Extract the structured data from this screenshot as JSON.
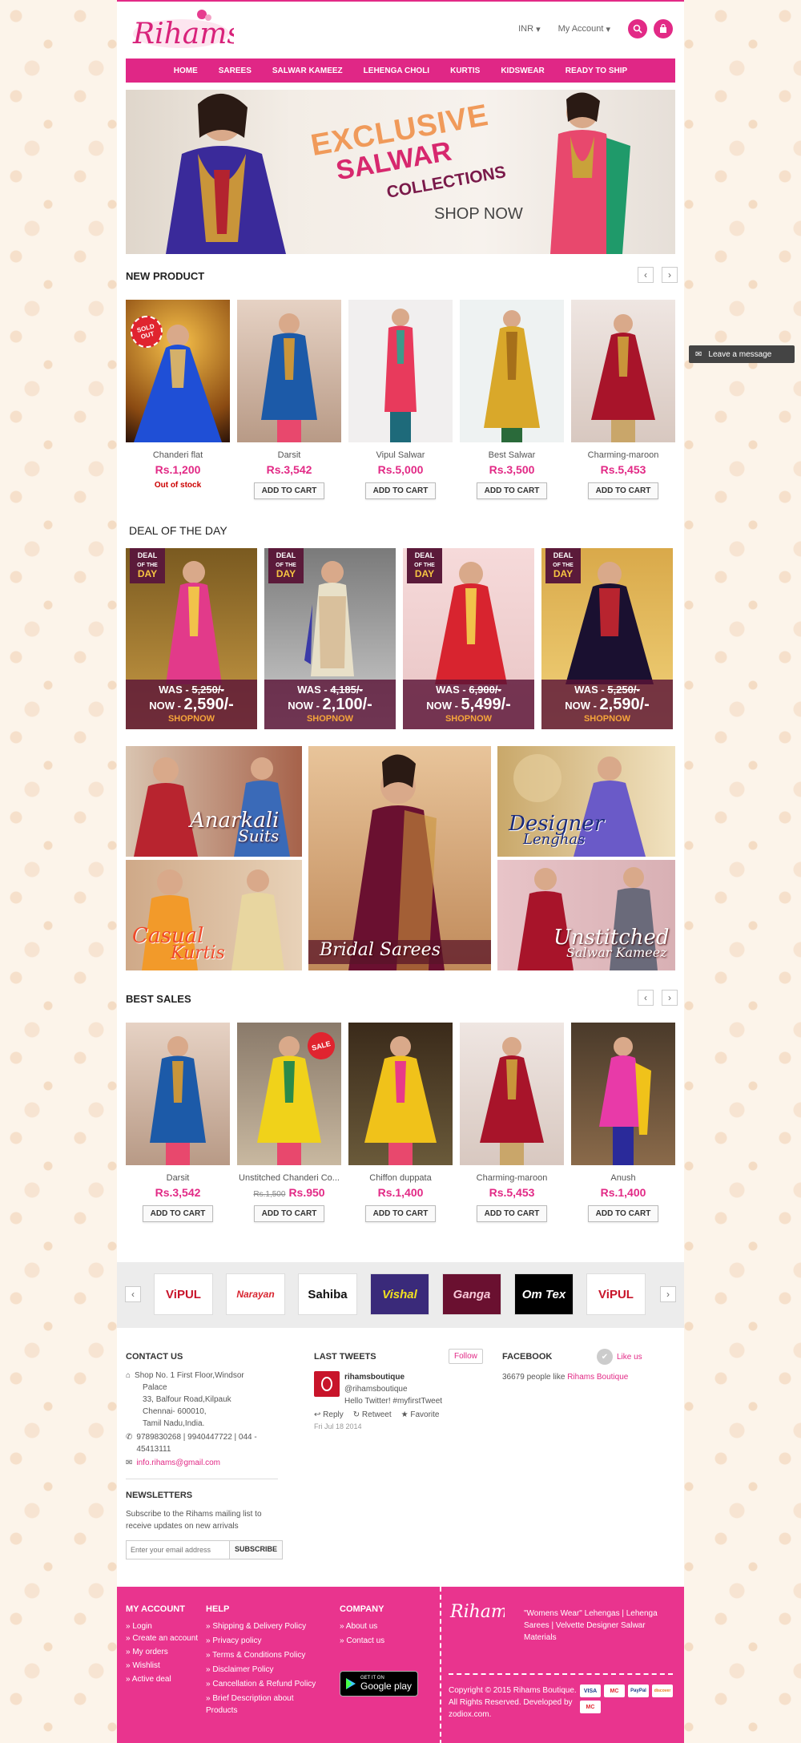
{
  "header": {
    "logo_text": "Rihams",
    "currency": "INR",
    "account": "My Account"
  },
  "nav": [
    "HOME",
    "SAREES",
    "SALWAR KAMEEZ",
    "LEHENGA CHOLI",
    "KURTIS",
    "KIDSWEAR",
    "READY TO SHIP"
  ],
  "banner": {
    "line1": "EXCLUSIVE",
    "line2": "SALWAR",
    "line3": "COLLECTIONS",
    "cta": "SHOP NOW"
  },
  "new_product": {
    "title": "NEW PRODUCT",
    "items": [
      {
        "name": "Chanderi flat",
        "price": "Rs.1,200",
        "status": "Out of stock",
        "badge": "SOLD OUT"
      },
      {
        "name": "Darsit",
        "price": "Rs.3,542",
        "cta": "ADD TO CART"
      },
      {
        "name": "Vipul Salwar",
        "price": "Rs.5,000",
        "cta": "ADD TO CART"
      },
      {
        "name": "Best Salwar",
        "price": "Rs.3,500",
        "cta": "ADD TO CART"
      },
      {
        "name": "Charming-maroon",
        "price": "Rs.5,453",
        "cta": "ADD TO CART"
      }
    ]
  },
  "deal": {
    "title": "DEAL OF THE DAY",
    "badge_top": "DEAL",
    "badge_mid": "OF THE",
    "badge_bottom": "DAY",
    "was_label": "WAS -",
    "now_label": "NOW -",
    "shop": "SHOPNOW",
    "items": [
      {
        "was": "5,250/-",
        "now": "2,590/-"
      },
      {
        "was": "4,185/-",
        "now": "2,100/-"
      },
      {
        "was": "6,900/-",
        "now": "5,499/-"
      },
      {
        "was": "5,250/-",
        "now": "2,590/-"
      }
    ]
  },
  "categories": [
    {
      "line1": "Anarkali",
      "line2": "Suits"
    },
    {
      "line1": "Casual",
      "line2": "Kurtis"
    },
    {
      "line1": "Bridal Sarees",
      "line2": ""
    },
    {
      "line1": "Designer",
      "line2": "Lenghas"
    },
    {
      "line1": "Unstitched",
      "line2": "Salwar Kameez"
    }
  ],
  "best_sales": {
    "title": "BEST SALES",
    "items": [
      {
        "name": "Darsit",
        "price": "Rs.3,542",
        "cta": "ADD TO CART"
      },
      {
        "name": "Unstitched Chanderi Co...",
        "old": "Rs.1,500",
        "price": "Rs.950",
        "cta": "ADD TO CART",
        "badge": "SALE"
      },
      {
        "name": "Chiffon duppata",
        "price": "Rs.1,400",
        "cta": "ADD TO CART"
      },
      {
        "name": "Charming-maroon",
        "price": "Rs.5,453",
        "cta": "ADD TO CART"
      },
      {
        "name": "Anush",
        "price": "Rs.1,400",
        "cta": "ADD TO CART"
      }
    ]
  },
  "brands": [
    "ViPUL",
    "Narayan",
    "Sahiba",
    "Vishal",
    "Ganga",
    "Om Tex",
    "ViPUL"
  ],
  "contact": {
    "title": "CONTACT US",
    "address": [
      "Shop No. 1 First Floor,Windsor",
      "Palace",
      "33, Balfour Road,Kilpauk",
      "Chennai- 600010,",
      "Tamil Nadu,India."
    ],
    "phone": "9789830268 | 9940447722 | 044 - 45413111",
    "email": "info.rihams@gmail.com"
  },
  "tweets": {
    "title": "LAST TWEETS",
    "follow": "Follow",
    "user": "rihamsboutique",
    "handle": "@rihamsboutique",
    "text": "Hello Twitter! #myfirstTweet",
    "reply": "Reply",
    "retweet": "Retweet",
    "favorite": "Favorite",
    "date": "Fri Jul 18 2014"
  },
  "facebook": {
    "title": "FACEBOOK",
    "like": "Like us",
    "people": "36679 people like",
    "page": "Rihams Boutique"
  },
  "newsletter": {
    "title": "NEWSLETTERS",
    "desc": "Subscribe to the Rihams mailing list to receive updates on new arrivals",
    "placeholder": "Enter your email address",
    "button": "SUBSCRIBE"
  },
  "footer": {
    "account_title": "MY ACCOUNT",
    "account": [
      "Login",
      "Create an account",
      "My orders",
      "Wishlist",
      "Active deal"
    ],
    "help_title": "HELP",
    "help": [
      "Shipping & Delivery Policy",
      "Privacy policy",
      "Terms & Conditions Policy",
      "Disclaimer Policy",
      "Cancellation & Refund Policy",
      "Brief Description about Products"
    ],
    "company_title": "COMPANY",
    "company": [
      "About us",
      "Contact us"
    ],
    "play_small": "GET IT ON",
    "play_big": "Google play",
    "tagline": "\"Womens Wear\" Lehengas | Lehenga Sarees | Velvette Designer Salwar Materials",
    "copyright": "Copyright © 2015 Rihams Boutique. All Rights Reserved. Developed by zodiox.com.",
    "payments": [
      "VISA",
      "MC",
      "PayPal",
      "discover",
      "MC"
    ]
  },
  "chat": {
    "label": "Leave a message"
  }
}
